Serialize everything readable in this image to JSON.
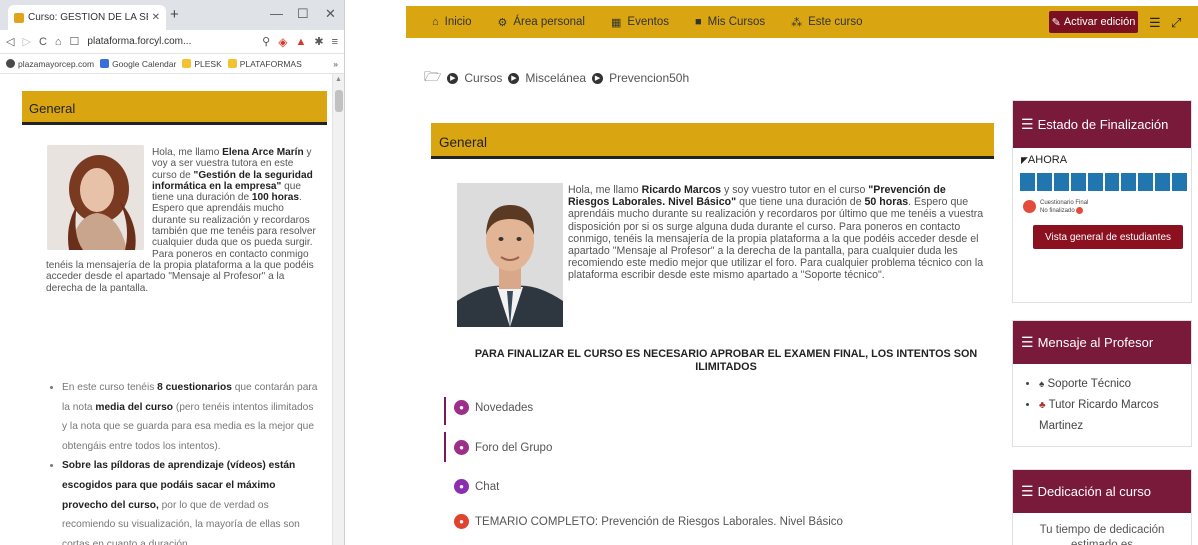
{
  "left": {
    "tab_title": "Curso: GESTIÓN DE LA SEGURID/",
    "url": "plataforma.forcyl.com...",
    "bookmarks": [
      "plazamayorcep.com",
      "Google Calendar",
      "PLESK",
      "PLATAFORMAS"
    ],
    "bookmark_more": "»",
    "section_title": "General",
    "intro": {
      "p1": "Hola, me llamo ",
      "name": "Elena Arce Marín",
      "p2": " y voy a ser vuestra tutora en este curso de ",
      "course": "\"Gestión de la seguridad informática en la empresa\"",
      "p3": " que tiene una duración de ",
      "hours": "100 horas",
      "p4": ". Espero que aprendáis mucho durante su realización y recordaros también que me tenéis para resolver cualquier duda que os pueda surgir. Para poneros en contacto conmigo tenéis la mensajería de la propia plataforma a la que podéis acceder desde el apartado \"Mensaje al Profesor\" a la derecha de la pantalla."
    },
    "list": {
      "li1_a": "En este curso tenéis ",
      "li1_b": "8 cuestionarios",
      "li1_c": " que contarán para la nota ",
      "li1_d": "media del curso",
      "li1_e": " (pero tenéis intentos ilimitados y la nota que se guarda para esa media es la mejor que obtengáis entre todos los intentos).",
      "li2_a": "Sobre las píldoras de aprendizaje (vídeos) están escogidos para que podáis sacar el máximo provecho del curso,",
      "li2_b": " por lo que de verdad os recomiendo su visualización, la mayoría de ellas son cortas en cuanto a duración."
    }
  },
  "right": {
    "nav": [
      "Inicio",
      "Área personal",
      "Eventos",
      "Mis Cursos",
      "Este curso"
    ],
    "edit_button": "Activar edición",
    "breadcrumb": [
      "Cursos",
      "Miscelánea",
      "Prevencion50h"
    ],
    "section_title": "General",
    "intro": {
      "p1": "Hola, me llamo ",
      "name": "Ricardo Marcos",
      "p2": " y soy vuestro tutor en el curso ",
      "course": "\"Prevención de Riesgos Laborales. Nivel Básico\"",
      "p3": " que tiene una duración de ",
      "hours": "50 horas",
      "p4": ". Espero que aprendáis mucho durante su realización y recordaros por último que me tenéis a vuestra disposición por si os surge alguna duda durante el curso. Para poneros en contacto conmigo, tenéis la mensajería de la propia plataforma a la que podéis acceder desde el apartado \"Mensaje al Profesor\" a la derecha de la pantalla, para cualquier duda les recomiendo este medio mejor que utilizar el foro. Para cualquier problema técnico con la plataforma escribir desde este mismo apartado a \"Soporte técnico\"."
    },
    "finalizar": "PARA FINALIZAR EL CURSO ES NECESARIO APROBAR EL EXAMEN FINAL, LOS INTENTOS SON ILIMITADOS",
    "activities": [
      "Novedades",
      "Foro del Grupo",
      "Chat",
      "TEMARIO COMPLETO: Prevención de Riesgos Laborales. Nivel Básico"
    ],
    "blocks": {
      "estado": {
        "title": "Estado de Finalización",
        "ahora": "AHORA",
        "item_name": "Cuestionario Final",
        "item_status": "No finalizado",
        "button": "Vista general de estudiantes"
      },
      "mensaje": {
        "title": "Mensaje al Profesor",
        "items": [
          "Soporte Técnico",
          "Tutor Ricardo Marcos Martinez"
        ]
      },
      "dedicacion": {
        "title": "Dedicación al curso",
        "text": "Tu tiempo de dedicación estimado es"
      }
    }
  },
  "colors": {
    "gold": "#d9a510",
    "maroon": "#7a1a3a",
    "progress_blue": "#2176b0"
  }
}
